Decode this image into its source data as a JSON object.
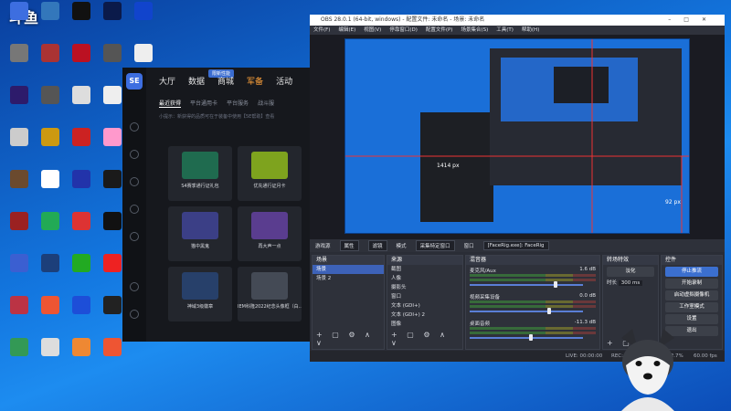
{
  "desktop": {
    "logo_text": "斗鱼",
    "icons": [
      {
        "label": "",
        "color": "#3d6ee0"
      },
      {
        "label": "",
        "color": "#777"
      },
      {
        "label": "",
        "color": "#2d1b6b"
      },
      {
        "label": "",
        "color": "#ccc"
      },
      {
        "label": "",
        "color": "#6b4a2e"
      },
      {
        "label": "",
        "color": "#9b2121"
      },
      {
        "label": "",
        "color": "#3b5fd1"
      },
      {
        "label": "",
        "color": "#b34"
      },
      {
        "label": "",
        "color": "#395"
      },
      {
        "label": "",
        "color": "#37b"
      },
      {
        "label": "",
        "color": "#a33"
      },
      {
        "label": "",
        "color": "#555"
      },
      {
        "label": "",
        "color": "#c91"
      },
      {
        "label": "",
        "color": "#fff"
      },
      {
        "label": "",
        "color": "#2a5"
      },
      {
        "label": "",
        "color": "#1c3f7a"
      },
      {
        "label": "",
        "color": "#e53"
      },
      {
        "label": "",
        "color": "#ddd"
      },
      {
        "label": "",
        "color": "#111"
      },
      {
        "label": "",
        "color": "#b12"
      },
      {
        "label": "",
        "color": "#ddd"
      },
      {
        "label": "",
        "color": "#c22"
      },
      {
        "label": "",
        "color": "#23a"
      },
      {
        "label": "",
        "color": "#d33"
      },
      {
        "label": "",
        "color": "#2a2"
      },
      {
        "label": "",
        "color": "#1d4ed8"
      },
      {
        "label": "",
        "color": "#e83"
      },
      {
        "label": "",
        "color": "#0b1a4a"
      },
      {
        "label": "",
        "color": "#555"
      },
      {
        "label": "",
        "color": "#eee"
      },
      {
        "label": "",
        "color": "#f9c"
      },
      {
        "label": "",
        "color": "#1a1a1a"
      },
      {
        "label": "",
        "color": "#111"
      },
      {
        "label": "",
        "color": "#e22"
      },
      {
        "label": "",
        "color": "#222"
      },
      {
        "label": "",
        "color": "#e53"
      },
      {
        "label": "",
        "color": "#14c"
      },
      {
        "label": "",
        "color": "#eee"
      },
      {
        "label": "",
        "color": "#e33"
      }
    ]
  },
  "game": {
    "logo": "SE",
    "badge": "限新性能",
    "nav": [
      "大厅",
      "数据",
      "商城",
      "军备",
      "活动"
    ],
    "nav_active": "军备",
    "subtabs": [
      "最近获得",
      "平台通用卡",
      "平台服务",
      "战斗服"
    ],
    "subtab_active": "最近获得",
    "hint": "小提示：新获得的品质可在于装备中使用【5E帮助】查看",
    "cards": [
      {
        "title": "S4赛季通行证礼包",
        "color": "#1f6b4f"
      },
      {
        "title": "优先通行证月卡",
        "color": "#7ea31e"
      },
      {
        "title": "猫中黑鬼",
        "color": "#3b3f86"
      },
      {
        "title": "再大声一点",
        "color": "#5a3d8f"
      },
      {
        "title": "神域3级徽章",
        "color": "#27406a"
      },
      {
        "title": "IEM科隆2022纪念头像框（白...",
        "color": "#444a55"
      }
    ]
  },
  "obs": {
    "title": "OBS 28.0.1 (64-bit, windows) - 配置文件: 未命名 - 场景: 未命名",
    "menu": [
      "文件(F)",
      "编辑(E)",
      "视图(V)",
      "停靠窗口(D)",
      "配置文件(P)",
      "场景集合(S)",
      "工具(T)",
      "帮助(H)"
    ],
    "ctx": {
      "source": "游戏源",
      "props": "属性",
      "filters": "滤镜",
      "mode_label": "模式",
      "mode": "采集特定窗口",
      "window_label": "窗口",
      "window": "[FaceRig.exe]: FaceRig"
    },
    "crop_labels": [
      "1414 px",
      "92 px"
    ],
    "scenes": {
      "header": "场景",
      "items": [
        "场景",
        "场景 2"
      ],
      "selected": "场景"
    },
    "sources": {
      "header": "来源",
      "items": [
        "截图",
        "人像",
        "摄影头",
        "窗口",
        "文本 (GDI+)",
        "文本 (GDI+) 2",
        "图像"
      ]
    },
    "mixer": {
      "header": "混音器",
      "channels": [
        {
          "name": "麦克风/Aux",
          "db": "1.6 dB",
          "level": 0.78
        },
        {
          "name": "视频采集设备",
          "db": "0.0 dB",
          "level": 0.72
        },
        {
          "name": "桌面音频",
          "db": "-11.3 dB",
          "level": 0.55
        }
      ]
    },
    "transitions": {
      "header": "转场特效",
      "type": "淡化",
      "duration_label": "时长",
      "duration": "300 ms"
    },
    "controls": {
      "header": "控件",
      "buttons": [
        "停止推流",
        "开始录制",
        "启动虚拟摄像机",
        "工作室模式",
        "设置",
        "退出"
      ],
      "active": "停止推流"
    },
    "status": {
      "live": "LIVE: 00:00:00",
      "rec": "REC: 00:00:00",
      "cpu": "CPU: 2.7%",
      "fps": "60.00 fps"
    }
  }
}
